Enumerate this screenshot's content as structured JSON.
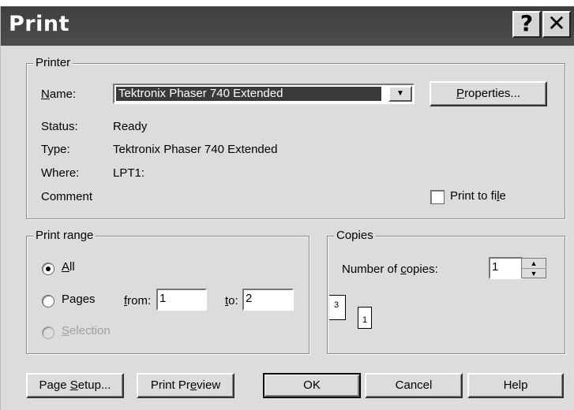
{
  "window": {
    "title": "Print",
    "help_glyph": "?",
    "close_glyph": "✕"
  },
  "printer": {
    "legend": "Printer",
    "name_label": "Name:",
    "name_value": "Tektronix Phaser 740 Extended",
    "properties_label": "Properties...",
    "status_label": "Status:",
    "status_value": "Ready",
    "type_label": "Type:",
    "type_value": "Tektronix Phaser 740 Extended",
    "where_label": "Where:",
    "where_value": "LPT1:",
    "comment_label": "Comment",
    "print_to_file_label": "Print to file"
  },
  "print_range": {
    "legend": "Print range",
    "all_label": "All",
    "pages_label": "Pages",
    "from_label": "from:",
    "from_value": "1",
    "to_label": "to:",
    "to_value": "2",
    "selection_label": "Selection"
  },
  "copies": {
    "legend": "Copies",
    "number_label": "Number of copies:",
    "number_value": "1",
    "page_icon_a": "3",
    "page_icon_b": "1"
  },
  "footer": {
    "page_setup": "Page Setup...",
    "print_preview": "Print Preview",
    "ok": "OK",
    "cancel": "Cancel",
    "help": "Help"
  }
}
